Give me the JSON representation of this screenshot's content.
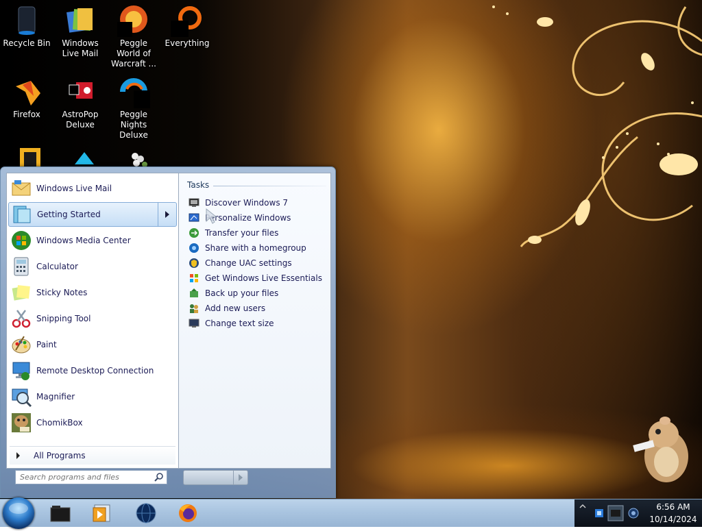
{
  "desktop": {
    "icons": [
      {
        "label": "Recycle Bin",
        "icon": "recycle-bin-icon"
      },
      {
        "label": "Windows Live Mail",
        "icon": "windows-live-mail-icon"
      },
      {
        "label": "Peggle World of Warcraft ...",
        "icon": "peggle-world-of-warcraft-icon"
      },
      {
        "label": "Everything",
        "icon": "everything-search-icon"
      },
      {
        "label": "Firefox",
        "icon": "firefox-icon"
      },
      {
        "label": "AstroPop Deluxe",
        "icon": "astropop-icon"
      },
      {
        "label": "Peggle Nights Deluxe",
        "icon": "peggle-nights-icon"
      }
    ]
  },
  "start_menu": {
    "programs": [
      {
        "label": "Windows Live Mail",
        "icon": "mail-icon"
      },
      {
        "label": "Getting Started",
        "icon": "getting-started-icon",
        "highlighted": true
      },
      {
        "label": "Windows Media Center",
        "icon": "media-center-icon"
      },
      {
        "label": "Calculator",
        "icon": "calculator-icon"
      },
      {
        "label": "Sticky Notes",
        "icon": "sticky-notes-icon"
      },
      {
        "label": "Snipping Tool",
        "icon": "scissors-icon"
      },
      {
        "label": "Paint",
        "icon": "paint-palette-icon"
      },
      {
        "label": "Remote Desktop Connection",
        "icon": "remote-desktop-icon"
      },
      {
        "label": "Magnifier",
        "icon": "magnifier-icon"
      },
      {
        "label": "ChomikBox",
        "icon": "chomikbox-icon"
      }
    ],
    "all_programs_label": "All Programs",
    "search_placeholder": "Search programs and files",
    "tasks": {
      "title": "Tasks",
      "items": [
        {
          "label": "Discover Windows 7",
          "icon": "monitor-icon"
        },
        {
          "label": "Personalize Windows",
          "icon": "personalize-icon"
        },
        {
          "label": "Transfer your files",
          "icon": "transfer-icon"
        },
        {
          "label": "Share with a homegroup",
          "icon": "homegroup-icon"
        },
        {
          "label": "Change UAC settings",
          "icon": "uac-shield-icon"
        },
        {
          "label": "Get Windows Live Essentials",
          "icon": "windows-flag-icon"
        },
        {
          "label": "Back up your files",
          "icon": "backup-icon"
        },
        {
          "label": "Add new users",
          "icon": "users-icon"
        },
        {
          "label": "Change text size",
          "icon": "text-size-icon"
        }
      ]
    }
  },
  "taskbar": {
    "pinned": [
      {
        "name": "explorer",
        "icon": "file-explorer-icon"
      },
      {
        "name": "media-player",
        "icon": "media-player-icon"
      },
      {
        "name": "internet",
        "icon": "globe-icon"
      },
      {
        "name": "firefox",
        "icon": "firefox-icon"
      }
    ],
    "clock": {
      "time": "6:56 AM",
      "date": "10/14/2024"
    }
  }
}
